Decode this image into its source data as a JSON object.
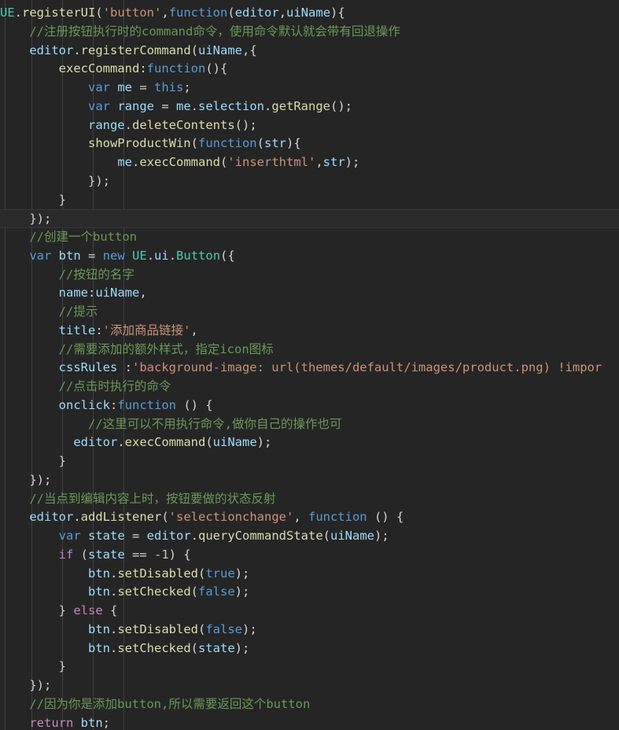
{
  "editor": {
    "theme": "dark-plus",
    "background_color": "#252526",
    "current_line_index": 11,
    "indent_guide_color": "#404040",
    "indent_guide_x": [
      6,
      40,
      79,
      118,
      157
    ],
    "language": "javascript",
    "colors": {
      "keyword": "#569cd6",
      "control": "#c586c0",
      "identifier": "#9cdcfe",
      "function": "#dcdcaa",
      "class": "#4ec9b0",
      "string": "#ce9178",
      "number": "#b5cea8",
      "comment": "#6a9955",
      "plain": "#d4d4d4"
    },
    "lines": [
      [
        {
          "t": "UE",
          "c": "cls"
        },
        {
          "t": ".",
          "c": "p"
        },
        {
          "t": "registerUI",
          "c": "fn"
        },
        {
          "t": "(",
          "c": "p"
        },
        {
          "t": "'button'",
          "c": "str"
        },
        {
          "t": ",",
          "c": "p"
        },
        {
          "t": "function",
          "c": "k"
        },
        {
          "t": "(",
          "c": "p"
        },
        {
          "t": "editor",
          "c": "id"
        },
        {
          "t": ",",
          "c": "p"
        },
        {
          "t": "uiName",
          "c": "id"
        },
        {
          "t": "){",
          "c": "p"
        }
      ],
      [
        {
          "t": "    ",
          "c": "p"
        },
        {
          "t": "//注册按钮执行时的command命令，使用命令默认就会带有回退操作",
          "c": "cm"
        }
      ],
      [
        {
          "t": "    ",
          "c": "p"
        },
        {
          "t": "editor",
          "c": "id"
        },
        {
          "t": ".",
          "c": "p"
        },
        {
          "t": "registerCommand",
          "c": "fn"
        },
        {
          "t": "(",
          "c": "p"
        },
        {
          "t": "uiName",
          "c": "id"
        },
        {
          "t": ",{",
          "c": "p"
        }
      ],
      [
        {
          "t": "        ",
          "c": "p"
        },
        {
          "t": "execCommand",
          "c": "fn"
        },
        {
          "t": ":",
          "c": "p"
        },
        {
          "t": "function",
          "c": "k"
        },
        {
          "t": "(){",
          "c": "p"
        }
      ],
      [
        {
          "t": "            ",
          "c": "p"
        },
        {
          "t": "var",
          "c": "k"
        },
        {
          "t": " ",
          "c": "p"
        },
        {
          "t": "me",
          "c": "id"
        },
        {
          "t": " = ",
          "c": "p"
        },
        {
          "t": "this",
          "c": "k"
        },
        {
          "t": ";",
          "c": "p"
        }
      ],
      [
        {
          "t": "            ",
          "c": "p"
        },
        {
          "t": "var",
          "c": "k"
        },
        {
          "t": " ",
          "c": "p"
        },
        {
          "t": "range",
          "c": "id"
        },
        {
          "t": " = ",
          "c": "p"
        },
        {
          "t": "me",
          "c": "id"
        },
        {
          "t": ".",
          "c": "p"
        },
        {
          "t": "selection",
          "c": "id"
        },
        {
          "t": ".",
          "c": "p"
        },
        {
          "t": "getRange",
          "c": "fn"
        },
        {
          "t": "();",
          "c": "p"
        }
      ],
      [
        {
          "t": "            ",
          "c": "p"
        },
        {
          "t": "range",
          "c": "id"
        },
        {
          "t": ".",
          "c": "p"
        },
        {
          "t": "deleteContents",
          "c": "fn"
        },
        {
          "t": "();",
          "c": "p"
        }
      ],
      [
        {
          "t": "            ",
          "c": "p"
        },
        {
          "t": "showProductWin",
          "c": "fn"
        },
        {
          "t": "(",
          "c": "p"
        },
        {
          "t": "function",
          "c": "k"
        },
        {
          "t": "(",
          "c": "p"
        },
        {
          "t": "str",
          "c": "id"
        },
        {
          "t": "){",
          "c": "p"
        }
      ],
      [
        {
          "t": "                ",
          "c": "p"
        },
        {
          "t": "me",
          "c": "id"
        },
        {
          "t": ".",
          "c": "p"
        },
        {
          "t": "execCommand",
          "c": "fn"
        },
        {
          "t": "(",
          "c": "p"
        },
        {
          "t": "'inserthtml'",
          "c": "str"
        },
        {
          "t": ",",
          "c": "p"
        },
        {
          "t": "str",
          "c": "id"
        },
        {
          "t": ");",
          "c": "p"
        }
      ],
      [
        {
          "t": "            ",
          "c": "p"
        },
        {
          "t": "});",
          "c": "p"
        }
      ],
      [
        {
          "t": "        ",
          "c": "p"
        },
        {
          "t": "}",
          "c": "p"
        }
      ],
      [
        {
          "t": "    ",
          "c": "p"
        },
        {
          "t": "});",
          "c": "p"
        }
      ],
      [
        {
          "t": "    ",
          "c": "p"
        },
        {
          "t": "//创建一个button",
          "c": "cm"
        }
      ],
      [
        {
          "t": "    ",
          "c": "p"
        },
        {
          "t": "var",
          "c": "k"
        },
        {
          "t": " ",
          "c": "p"
        },
        {
          "t": "btn",
          "c": "id"
        },
        {
          "t": " = ",
          "c": "p"
        },
        {
          "t": "new",
          "c": "k"
        },
        {
          "t": " ",
          "c": "p"
        },
        {
          "t": "UE",
          "c": "cls"
        },
        {
          "t": ".",
          "c": "p"
        },
        {
          "t": "ui",
          "c": "id"
        },
        {
          "t": ".",
          "c": "p"
        },
        {
          "t": "Button",
          "c": "cls"
        },
        {
          "t": "({",
          "c": "p"
        }
      ],
      [
        {
          "t": "        ",
          "c": "p"
        },
        {
          "t": "//按钮的名字",
          "c": "cm"
        }
      ],
      [
        {
          "t": "        ",
          "c": "p"
        },
        {
          "t": "name",
          "c": "id"
        },
        {
          "t": ":",
          "c": "p"
        },
        {
          "t": "uiName",
          "c": "id"
        },
        {
          "t": ",",
          "c": "p"
        }
      ],
      [
        {
          "t": "        ",
          "c": "p"
        },
        {
          "t": "//提示",
          "c": "cm"
        }
      ],
      [
        {
          "t": "        ",
          "c": "p"
        },
        {
          "t": "title",
          "c": "id"
        },
        {
          "t": ":",
          "c": "p"
        },
        {
          "t": "'添加商品链接'",
          "c": "str"
        },
        {
          "t": ",",
          "c": "p"
        }
      ],
      [
        {
          "t": "        ",
          "c": "p"
        },
        {
          "t": "//需要添加的额外样式，指定icon图标",
          "c": "cm"
        }
      ],
      [
        {
          "t": "        ",
          "c": "p"
        },
        {
          "t": "cssRules",
          "c": "id"
        },
        {
          "t": " :",
          "c": "p"
        },
        {
          "t": "'background-image: url(themes/default/images/product.png) !impor",
          "c": "str"
        }
      ],
      [
        {
          "t": "        ",
          "c": "p"
        },
        {
          "t": "//点击时执行的命令",
          "c": "cm"
        }
      ],
      [
        {
          "t": "        ",
          "c": "p"
        },
        {
          "t": "onclick",
          "c": "id"
        },
        {
          "t": ":",
          "c": "p"
        },
        {
          "t": "function",
          "c": "k"
        },
        {
          "t": " () {",
          "c": "p"
        }
      ],
      [
        {
          "t": "            ",
          "c": "p"
        },
        {
          "t": "//这里可以不用执行命令,做你自己的操作也可",
          "c": "cm"
        }
      ],
      [
        {
          "t": "          ",
          "c": "p"
        },
        {
          "t": "editor",
          "c": "id"
        },
        {
          "t": ".",
          "c": "p"
        },
        {
          "t": "execCommand",
          "c": "fn"
        },
        {
          "t": "(",
          "c": "p"
        },
        {
          "t": "uiName",
          "c": "id"
        },
        {
          "t": ");",
          "c": "p"
        }
      ],
      [
        {
          "t": "        ",
          "c": "p"
        },
        {
          "t": "}",
          "c": "p"
        }
      ],
      [
        {
          "t": "    ",
          "c": "p"
        },
        {
          "t": "});",
          "c": "p"
        }
      ],
      [
        {
          "t": "    ",
          "c": "p"
        },
        {
          "t": "//当点到编辑内容上时，按钮要做的状态反射",
          "c": "cm"
        }
      ],
      [
        {
          "t": "    ",
          "c": "p"
        },
        {
          "t": "editor",
          "c": "id"
        },
        {
          "t": ".",
          "c": "p"
        },
        {
          "t": "addListener",
          "c": "fn"
        },
        {
          "t": "(",
          "c": "p"
        },
        {
          "t": "'selectionchange'",
          "c": "str"
        },
        {
          "t": ", ",
          "c": "p"
        },
        {
          "t": "function",
          "c": "k"
        },
        {
          "t": " () {",
          "c": "p"
        }
      ],
      [
        {
          "t": "        ",
          "c": "p"
        },
        {
          "t": "var",
          "c": "k"
        },
        {
          "t": " ",
          "c": "p"
        },
        {
          "t": "state",
          "c": "id"
        },
        {
          "t": " = ",
          "c": "p"
        },
        {
          "t": "editor",
          "c": "id"
        },
        {
          "t": ".",
          "c": "p"
        },
        {
          "t": "queryCommandState",
          "c": "fn"
        },
        {
          "t": "(",
          "c": "p"
        },
        {
          "t": "uiName",
          "c": "id"
        },
        {
          "t": ");",
          "c": "p"
        }
      ],
      [
        {
          "t": "        ",
          "c": "p"
        },
        {
          "t": "if",
          "c": "ctl"
        },
        {
          "t": " (",
          "c": "p"
        },
        {
          "t": "state",
          "c": "id"
        },
        {
          "t": " == ",
          "c": "p"
        },
        {
          "t": "-1",
          "c": "num"
        },
        {
          "t": ") {",
          "c": "p"
        }
      ],
      [
        {
          "t": "            ",
          "c": "p"
        },
        {
          "t": "btn",
          "c": "id"
        },
        {
          "t": ".",
          "c": "p"
        },
        {
          "t": "setDisabled",
          "c": "fn"
        },
        {
          "t": "(",
          "c": "p"
        },
        {
          "t": "true",
          "c": "k"
        },
        {
          "t": ");",
          "c": "p"
        }
      ],
      [
        {
          "t": "            ",
          "c": "p"
        },
        {
          "t": "btn",
          "c": "id"
        },
        {
          "t": ".",
          "c": "p"
        },
        {
          "t": "setChecked",
          "c": "fn"
        },
        {
          "t": "(",
          "c": "p"
        },
        {
          "t": "false",
          "c": "k"
        },
        {
          "t": ");",
          "c": "p"
        }
      ],
      [
        {
          "t": "        ",
          "c": "p"
        },
        {
          "t": "} ",
          "c": "p"
        },
        {
          "t": "else",
          "c": "ctl"
        },
        {
          "t": " {",
          "c": "p"
        }
      ],
      [
        {
          "t": "            ",
          "c": "p"
        },
        {
          "t": "btn",
          "c": "id"
        },
        {
          "t": ".",
          "c": "p"
        },
        {
          "t": "setDisabled",
          "c": "fn"
        },
        {
          "t": "(",
          "c": "p"
        },
        {
          "t": "false",
          "c": "k"
        },
        {
          "t": ");",
          "c": "p"
        }
      ],
      [
        {
          "t": "            ",
          "c": "p"
        },
        {
          "t": "btn",
          "c": "id"
        },
        {
          "t": ".",
          "c": "p"
        },
        {
          "t": "setChecked",
          "c": "fn"
        },
        {
          "t": "(",
          "c": "p"
        },
        {
          "t": "state",
          "c": "id"
        },
        {
          "t": ");",
          "c": "p"
        }
      ],
      [
        {
          "t": "        ",
          "c": "p"
        },
        {
          "t": "}",
          "c": "p"
        }
      ],
      [
        {
          "t": "    ",
          "c": "p"
        },
        {
          "t": "});",
          "c": "p"
        }
      ],
      [
        {
          "t": "    ",
          "c": "p"
        },
        {
          "t": "//因为你是添加button,所以需要返回这个button",
          "c": "cm"
        }
      ],
      [
        {
          "t": "    ",
          "c": "p"
        },
        {
          "t": "return",
          "c": "ctl"
        },
        {
          "t": " ",
          "c": "p"
        },
        {
          "t": "btn",
          "c": "id"
        },
        {
          "t": ";",
          "c": "p"
        }
      ]
    ]
  }
}
